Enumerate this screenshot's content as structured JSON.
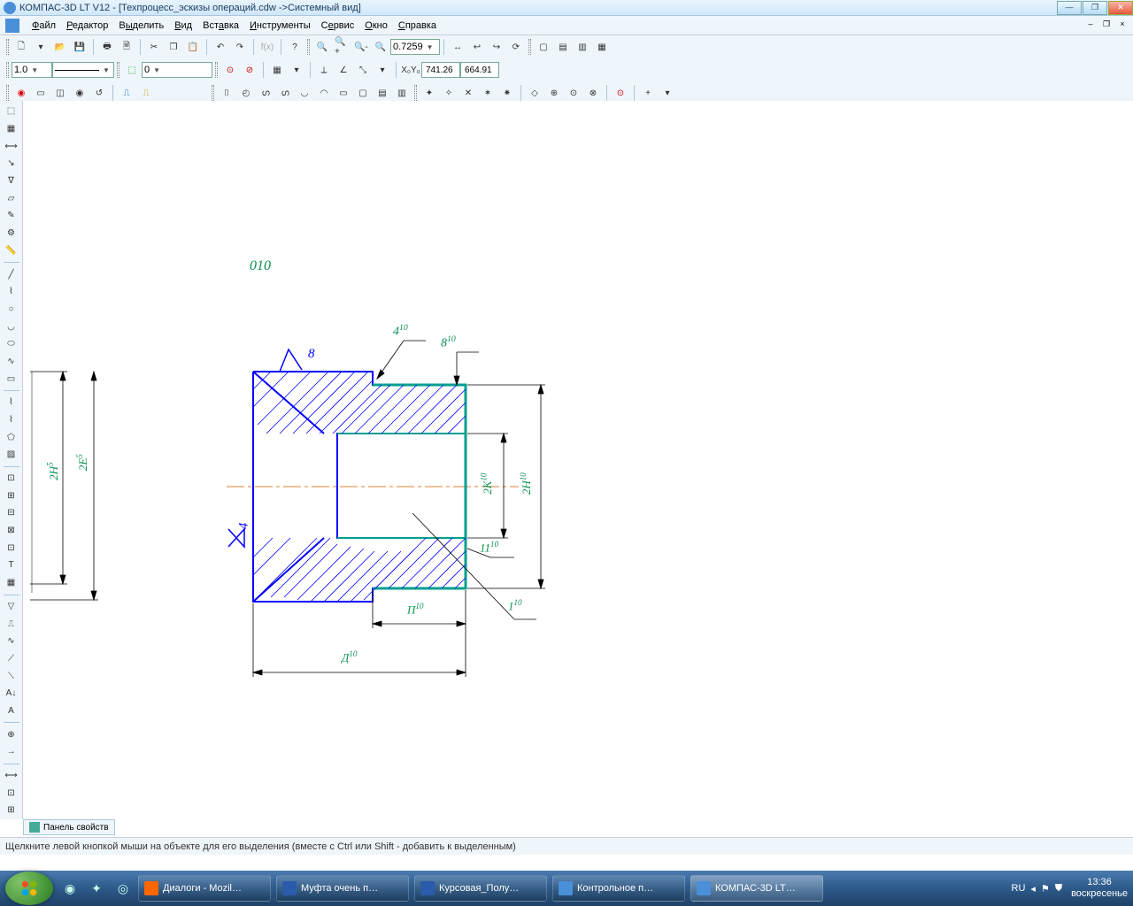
{
  "title": "КОМПАС-3D LT V12 - [Техпроцесс_эскизы операций.cdw ->Системный вид]",
  "menu": {
    "file": "Файл",
    "editor": "Редактор",
    "select": "Выделить",
    "view": "Вид",
    "insert": "Вставка",
    "tools": "Инструменты",
    "service": "Сервис",
    "window": "Окно",
    "help": "Справка"
  },
  "toolbar1": {
    "zoom": "0.7259"
  },
  "toolbar2": {
    "lineweight": "1.0",
    "layer": "0",
    "coord_x": "741.26",
    "coord_y": "664.91"
  },
  "drawing": {
    "op": "010",
    "d8": "8",
    "d4": "4",
    "a4_10": "4",
    "a4_10s": "10",
    "a8_10": "8",
    "a8_10s": "10",
    "a2H5": "2H",
    "a2H5s": "5",
    "a2E5": "2E",
    "a2E5s": "5",
    "a2K10": "2K",
    "a2K10s": "10",
    "a2H10": "2H",
    "a2H10s": "10",
    "a11_10": "11",
    "a11_10s": "10",
    "a1_10": "1",
    "a1_10s": "10",
    "aP10": "П",
    "aP10s": "10",
    "aD10": "Д",
    "aD10s": "10"
  },
  "proppanel": "Панель свойств",
  "status": "Щелкните левой кнопкой мыши на объекте для его выделения (вместе с Ctrl или Shift - добавить к выделенным)",
  "taskbar": {
    "t1": "Диалоги - Mozil…",
    "t2": "Муфта очень п…",
    "t3": "Курсовая_Полу…",
    "t4": "Контрольное п…",
    "t5": "КОМПАС-3D LT…",
    "lang": "RU",
    "time": "13:36",
    "day": "воскресенье"
  }
}
